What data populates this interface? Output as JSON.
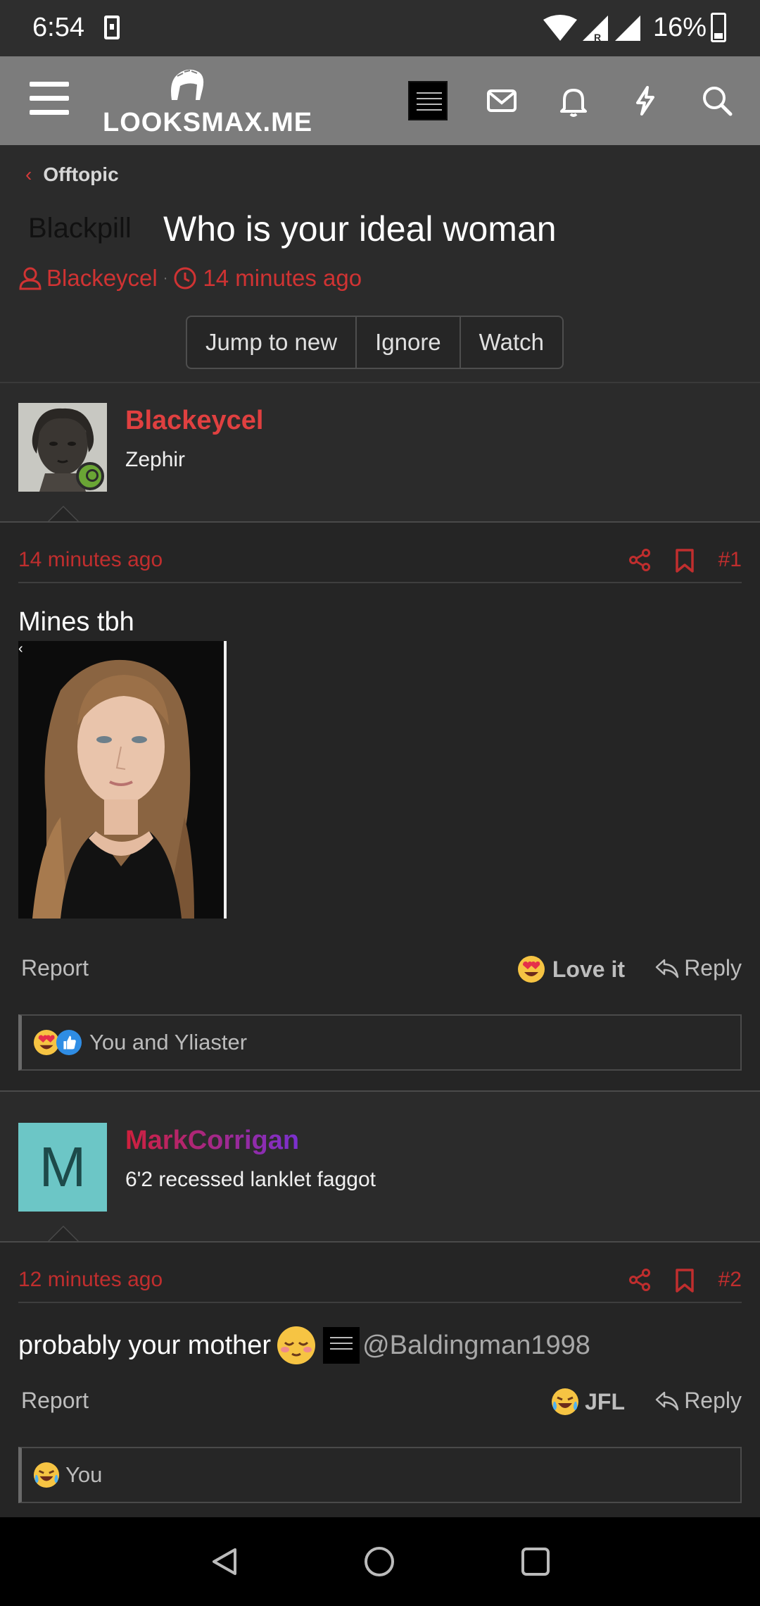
{
  "status_bar": {
    "time": "6:54",
    "battery": "16%"
  },
  "header": {
    "logo_text": "LOOKSMAX.ME"
  },
  "breadcrumb": {
    "label": "Offtopic"
  },
  "thread": {
    "prefix": "Blackpill",
    "title": "Who is your ideal woman",
    "author": "Blackeycel",
    "time": "14 minutes ago",
    "buttons": [
      "Jump to new",
      "Ignore",
      "Watch"
    ]
  },
  "posts": [
    {
      "username": "Blackeycel",
      "username_color": "#e04040",
      "user_title": "Zephir",
      "date": "14 minutes ago",
      "number": "#1",
      "message": "Mines tbh",
      "report": "Report",
      "reaction_label": "Love it",
      "reply": "Reply",
      "reactions_summary": "You and Yliaster"
    },
    {
      "username": "MarkCorrigan",
      "username_color": "#b0288a",
      "user_title": "6'2 recessed lanklet faggot",
      "avatar_letter": "M",
      "avatar_color": "#6cc6c6",
      "date": "12 minutes ago",
      "number": "#2",
      "message": "probably your mother",
      "mention": "@Baldingman1998",
      "report": "Report",
      "reaction_label": "JFL",
      "reply": "Reply",
      "reactions_summary": "You"
    }
  ],
  "colors": {
    "accent_red": "#c02e2e",
    "header_bg": "#7c7c7c",
    "online_green": "#6aa535"
  }
}
